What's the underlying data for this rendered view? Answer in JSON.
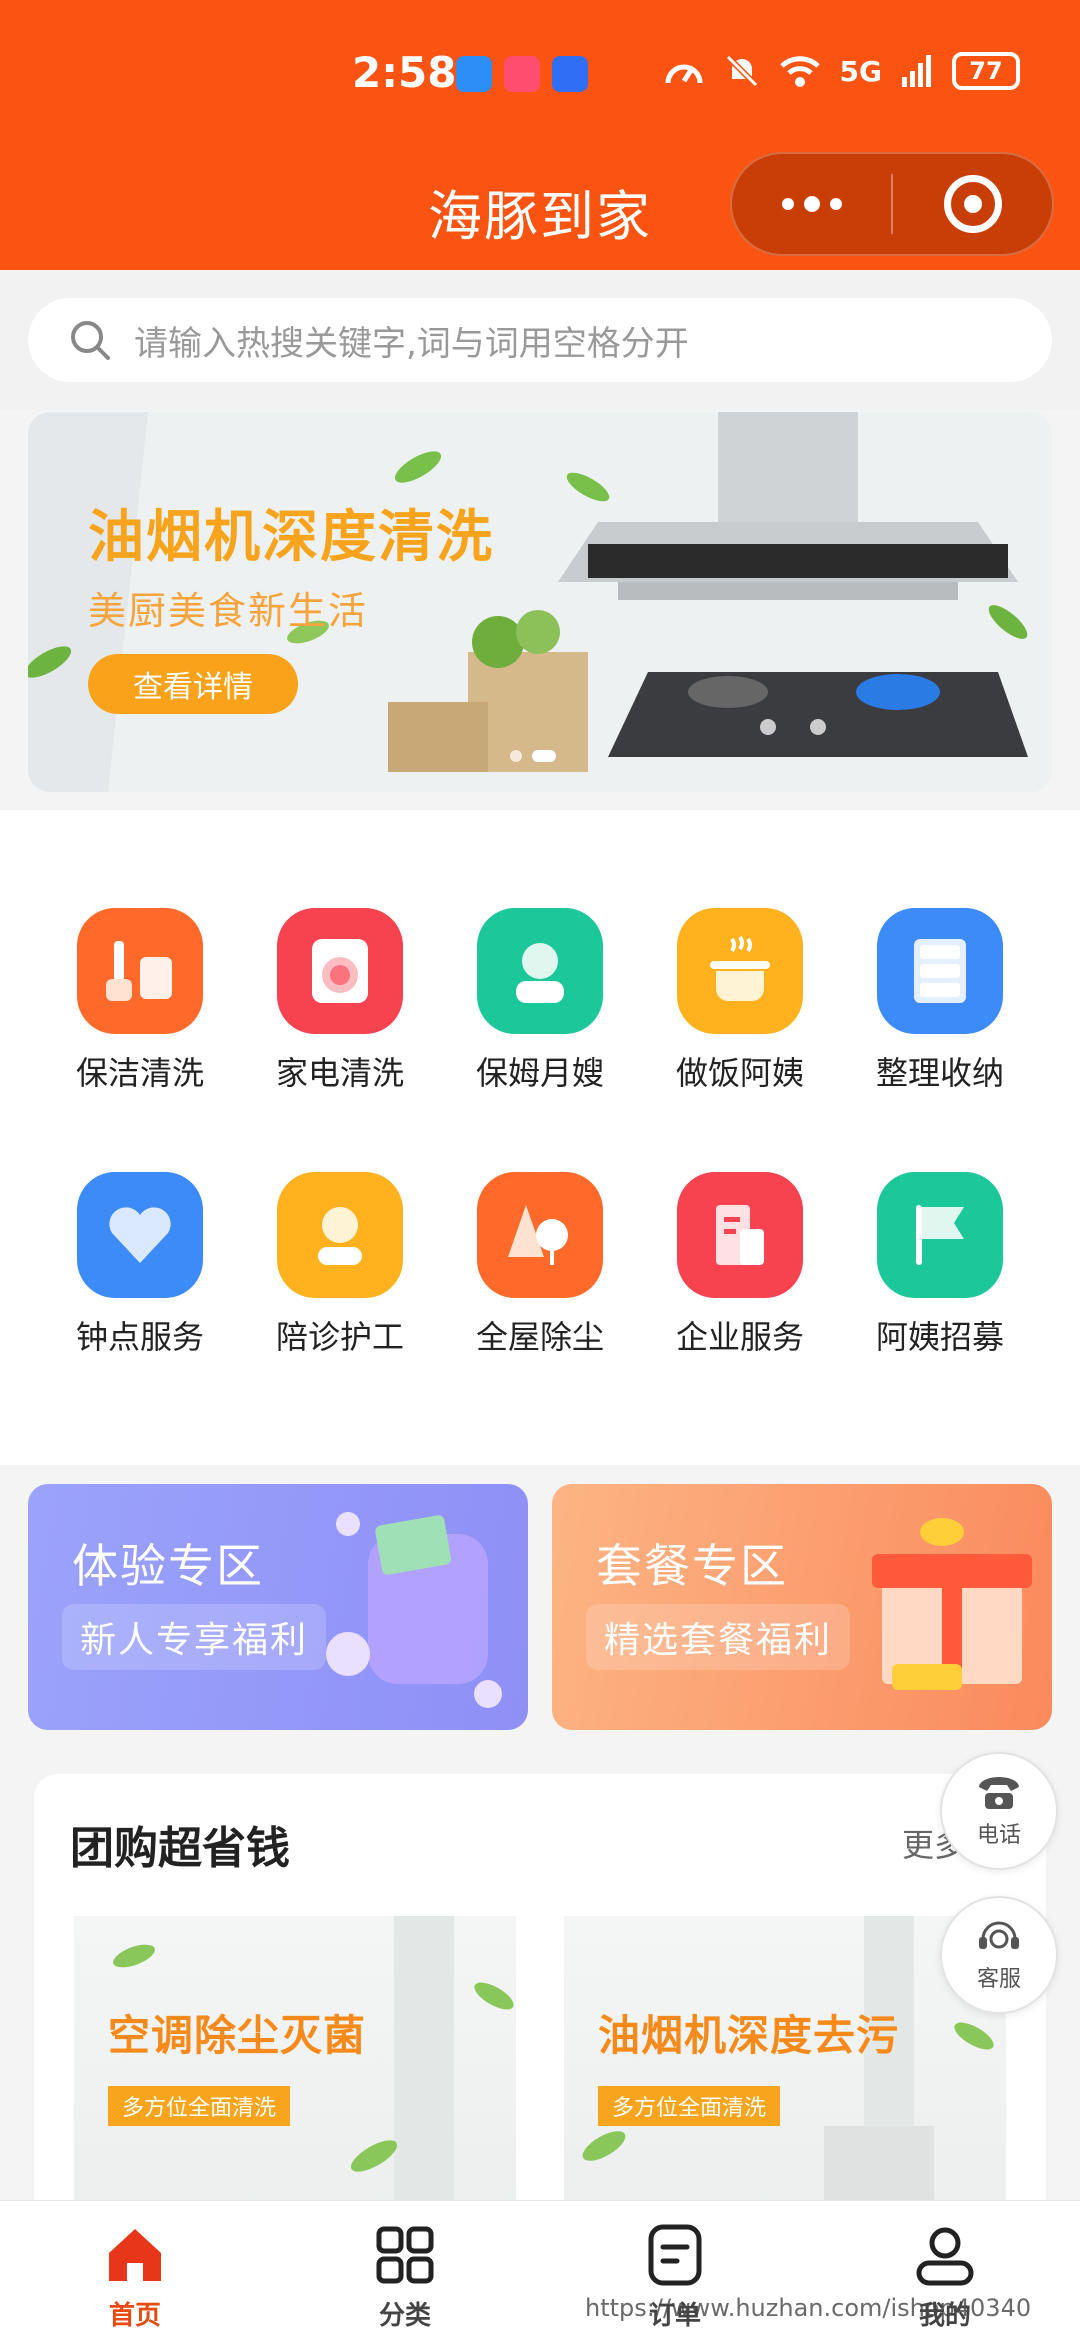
{
  "status_bar": {
    "time": "2:58",
    "network": "5G",
    "battery": "77"
  },
  "header": {
    "title": "海豚到家"
  },
  "search": {
    "placeholder": "请输入热搜关键字,词与词用空格分开"
  },
  "banner": {
    "title": "油烟机深度清洗",
    "subtitle": "美厨美食新生活",
    "button": "查看详情"
  },
  "services": [
    {
      "label": "保洁清洗",
      "icon": "cleaning-tools-icon",
      "color": "#ff6a2a"
    },
    {
      "label": "家电清洗",
      "icon": "washing-machine-icon",
      "color": "#f7424f"
    },
    {
      "label": "保姆月嫂",
      "icon": "nanny-icon",
      "color": "#1cc79a"
    },
    {
      "label": "做饭阿姨",
      "icon": "cooking-pot-icon",
      "color": "#ffb21e"
    },
    {
      "label": "整理收纳",
      "icon": "cabinet-icon",
      "color": "#3d8bf7"
    },
    {
      "label": "钟点服务",
      "icon": "heart-icon",
      "color": "#3d8bf7"
    },
    {
      "label": "陪诊护工",
      "icon": "nurse-icon",
      "color": "#ffb21e"
    },
    {
      "label": "全屋除尘",
      "icon": "tree-icon",
      "color": "#ff6a2a"
    },
    {
      "label": "企业服务",
      "icon": "building-icon",
      "color": "#f7424f"
    },
    {
      "label": "阿姨招募",
      "icon": "flag-icon",
      "color": "#1cc79a"
    }
  ],
  "promos": [
    {
      "title": "体验专区",
      "subtitle": "新人专享福利"
    },
    {
      "title": "套餐专区",
      "subtitle": "精选套餐福利"
    }
  ],
  "group_buy": {
    "title": "团购超省钱",
    "more": "更多",
    "cards": [
      {
        "title": "空调除尘灭菌",
        "tag": "多方位全面清洗"
      },
      {
        "title": "油烟机深度去污",
        "tag": "多方位全面清洗"
      }
    ]
  },
  "floating": {
    "phone": "电话",
    "service": "客服"
  },
  "tabbar": [
    {
      "label": "首页"
    },
    {
      "label": "分类"
    },
    {
      "label": "订单"
    },
    {
      "label": "我的"
    }
  ],
  "watermark": "https://www.huzhan.com/ishop40340"
}
